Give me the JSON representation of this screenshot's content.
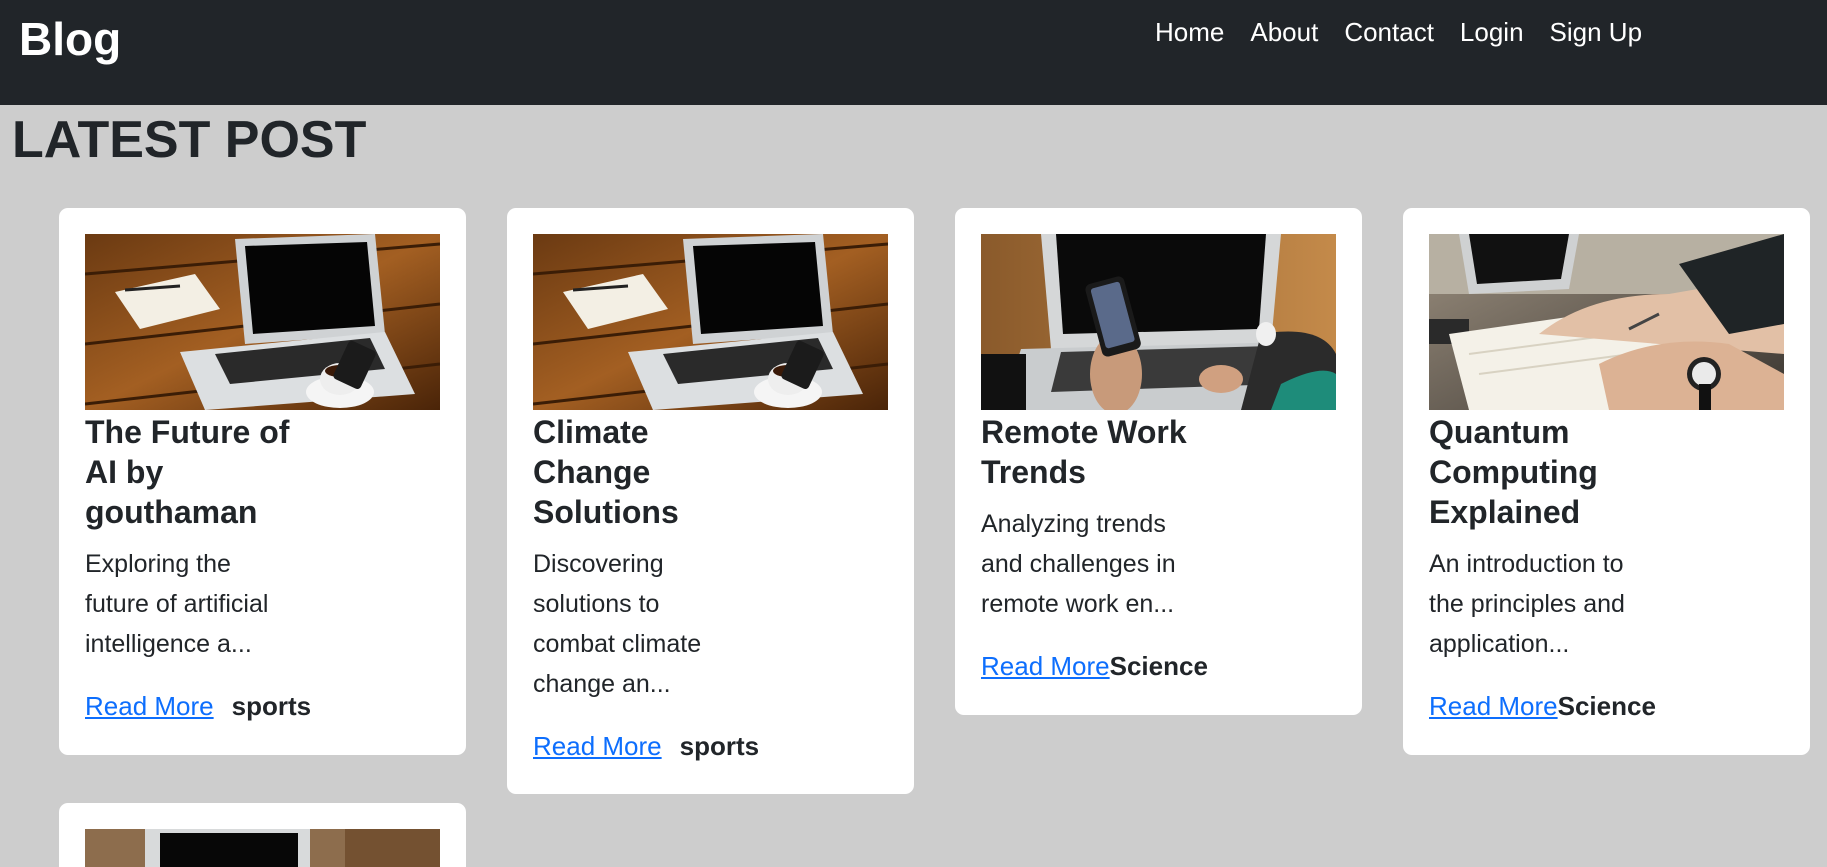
{
  "navbar": {
    "brand": "Blog",
    "links": [
      "Home",
      "About",
      "Contact",
      "Login",
      "Sign Up"
    ]
  },
  "main": {
    "section_title": "LATEST POST",
    "posts": [
      {
        "title": "The Future of AI by gouthaman",
        "excerpt": "Exploring the future of artificial intelligence a...",
        "read_more": "Read More",
        "category": "sports",
        "image": "laptop-coffee-desk-photo"
      },
      {
        "title": "Climate Change Solutions",
        "excerpt": "Discovering solutions to combat climate change an...",
        "read_more": "Read More",
        "category": "sports",
        "image": "laptop-coffee-desk-photo"
      },
      {
        "title": "Remote Work Trends",
        "excerpt": "Analyzing trends and challenges in remote work en...",
        "read_more": "Read More",
        "category": "Science",
        "image": "phone-laptop-hands-photo"
      },
      {
        "title": "Quantum Computing Explained",
        "excerpt": "An introduction to the principles and application...",
        "read_more": "Read More",
        "category": "Science",
        "image": "notebook-writing-watch-photo"
      },
      {
        "image": "laptop-blurred-photo"
      }
    ]
  }
}
